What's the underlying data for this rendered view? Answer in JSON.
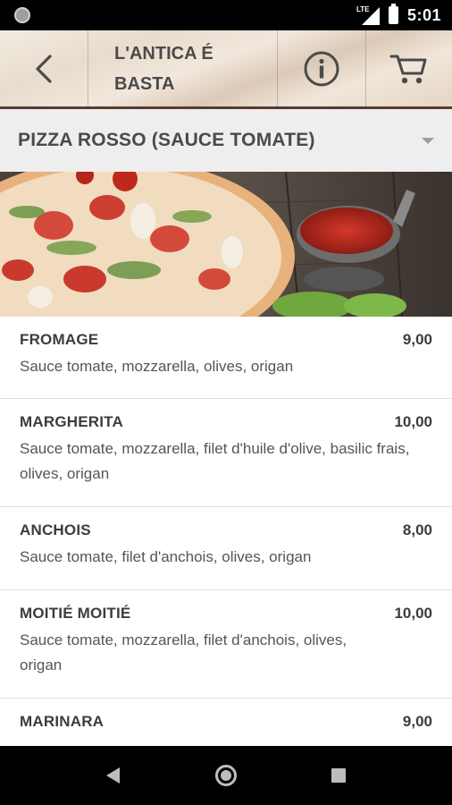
{
  "status_bar": {
    "network": "LTE",
    "time": "5:01"
  },
  "header": {
    "title": "L'ANTICA É BASTA",
    "icons": {
      "back": "back-arrow-icon",
      "info": "info-icon",
      "cart": "cart-icon"
    }
  },
  "category": {
    "selected": "PIZZA ROSSO (SAUCE TOMATE)"
  },
  "menu": {
    "items": [
      {
        "name": "FROMAGE",
        "price": "9,00",
        "description": "Sauce tomate, mozzarella, olives, origan"
      },
      {
        "name": "MARGHERITA",
        "price": "10,00",
        "description": "Sauce tomate, mozzarella, filet d'huile d'olive, basilic frais, olives, origan"
      },
      {
        "name": "ANCHOIS",
        "price": "8,00",
        "description": "Sauce tomate, filet d'anchois, olives, origan"
      },
      {
        "name": "MOITIÉ MOITIÉ",
        "price": "10,00",
        "description": "Sauce tomate, mozzarella, filet d'anchois, olives, origan"
      },
      {
        "name": "MARINARA",
        "price": "9,00",
        "description": ""
      }
    ]
  },
  "colors": {
    "header_rule": "#5a3b2e",
    "text_dark": "#3c3c3c",
    "category_bg": "#eeeeee"
  }
}
